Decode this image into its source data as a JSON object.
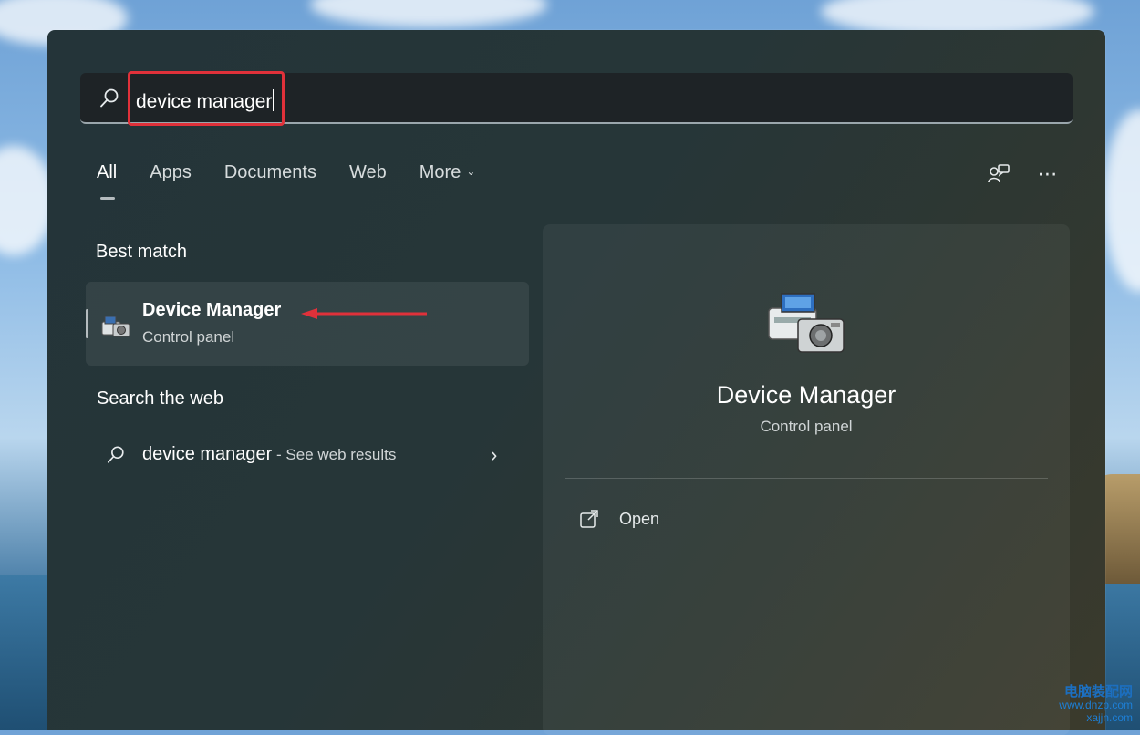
{
  "search": {
    "query": "device manager"
  },
  "tabs": [
    {
      "label": "All",
      "active": true
    },
    {
      "label": "Apps"
    },
    {
      "label": "Documents"
    },
    {
      "label": "Web"
    },
    {
      "label": "More"
    }
  ],
  "sections": {
    "best_match": "Best match",
    "search_web": "Search the web"
  },
  "best_match": {
    "title": "Device Manager",
    "subtitle": "Control panel"
  },
  "web_result": {
    "query": "device manager",
    "suffix": " - See web results"
  },
  "detail": {
    "title": "Device Manager",
    "subtitle": "Control panel",
    "open_label": "Open"
  },
  "icons": {
    "search": "search-icon",
    "feedback": "feedback-icon",
    "more": "more-options-icon",
    "app": "device-manager-icon",
    "open": "open-external-icon",
    "chevron": "chevron-right-icon"
  },
  "colors": {
    "highlight": "#e0313a",
    "panel": "#263638"
  },
  "watermark": {
    "line1": "电脑装配网",
    "line2": "www.dnzp.com",
    "line3": "xajjn.com"
  }
}
